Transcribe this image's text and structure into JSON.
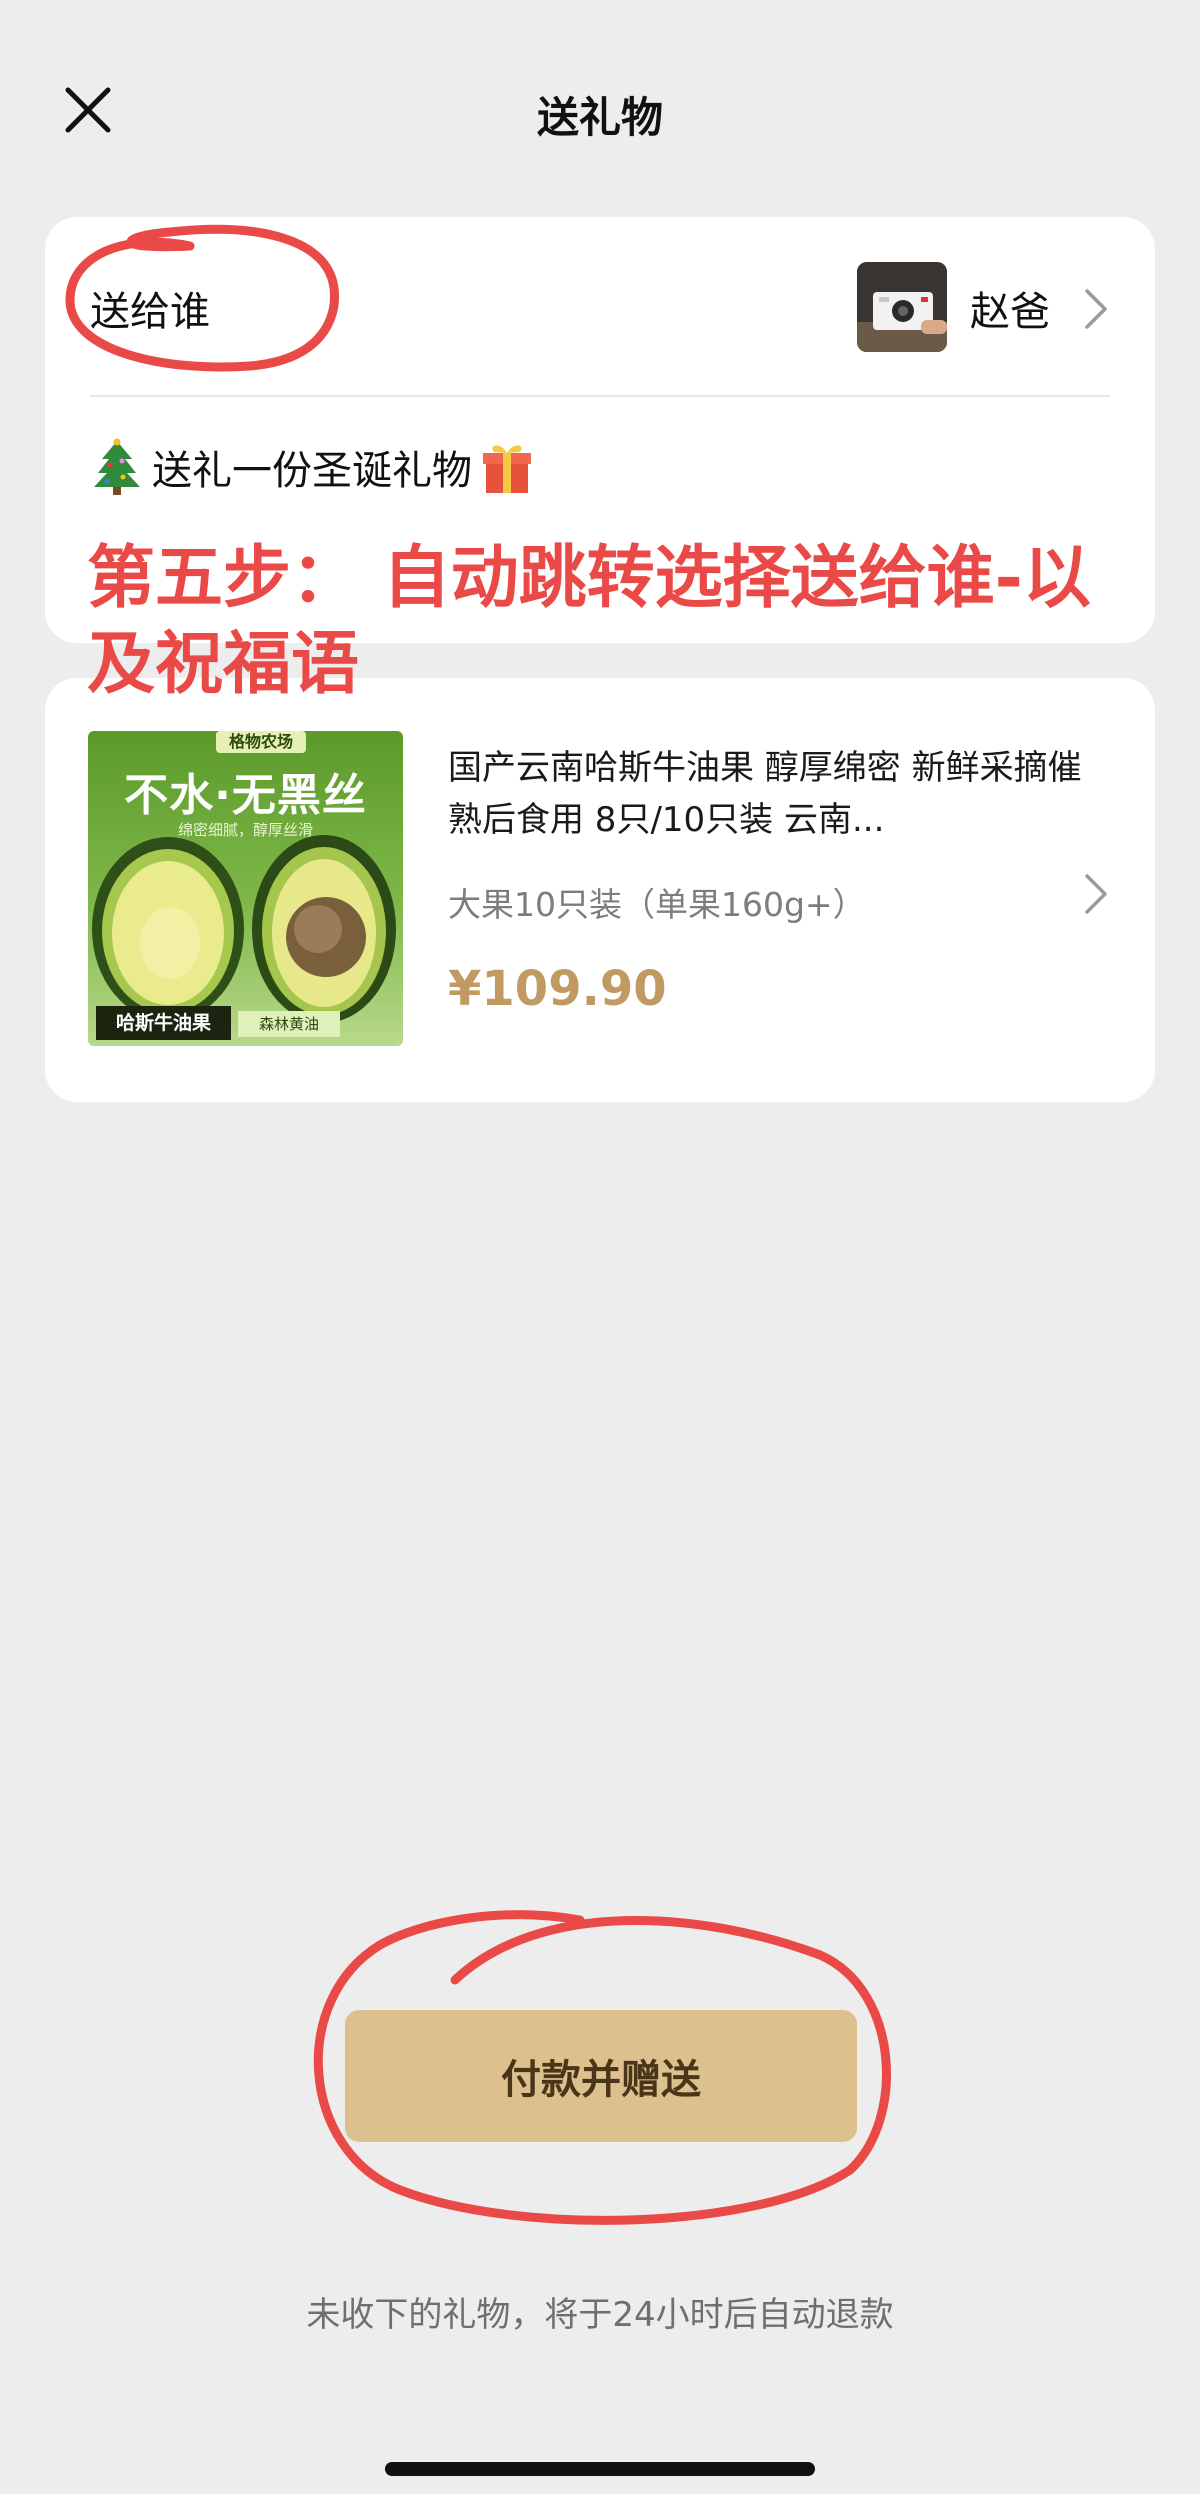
{
  "header": {
    "title": "送礼物",
    "close_icon": "close-icon"
  },
  "recipient": {
    "label": "送给谁",
    "name": "赵爸",
    "avatar_icon": "camera-avatar"
  },
  "blessing": {
    "text": "送礼一份圣诞礼物",
    "leading_icon": "christmas-tree-emoji",
    "trailing_icon": "gift-emoji"
  },
  "annotation": {
    "text": "第五步：  自动跳转选择送给谁-以及祝福语",
    "color": "#ea4a47"
  },
  "product": {
    "title": "国产云南哈斯牛油果 醇厚绵密 新鲜采摘催熟后食用 8只/10只装 云南...",
    "spec": "大果10只装（单果160g+）",
    "price": "¥109.90",
    "price_color": "#c19a63",
    "image": {
      "brand": "格物农场",
      "headline": "不水·无黑丝",
      "subline": "绵密细腻，醇厚丝滑",
      "tag_left": "哈斯牛油果",
      "tag_right": "森林黄油"
    }
  },
  "pay_button": {
    "label": "付款并赠送",
    "color": "#dcc18f"
  },
  "refund_note": "未收下的礼物，将于24小时后自动退款"
}
